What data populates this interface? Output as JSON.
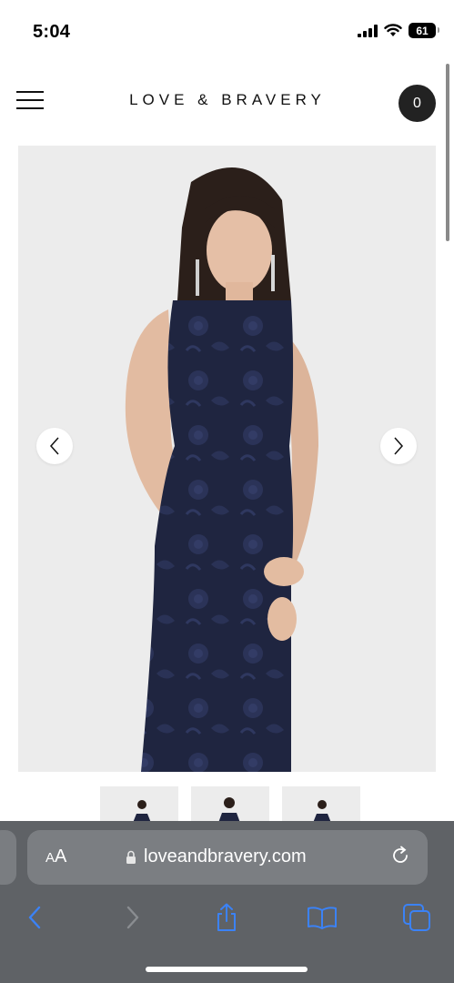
{
  "status_bar": {
    "time": "5:04",
    "battery_level": "61",
    "icons": [
      "cellular-signal-icon",
      "wifi-icon",
      "battery-icon"
    ]
  },
  "header": {
    "brand": "LOVE & BRAVERY",
    "cart_count": "0",
    "icons": [
      "hamburger-menu-icon"
    ]
  },
  "carousel": {
    "image_alt": "Model wearing navy floral jacquard sleeveless qipao dress",
    "prev_icon": "chevron-left-icon",
    "next_icon": "chevron-right-icon",
    "thumbnail_count": 3
  },
  "browser": {
    "aa_label_small": "A",
    "aa_label_large": "A",
    "url": "loveandbravery.com",
    "icons": [
      "lock-icon",
      "reload-icon",
      "back-icon",
      "forward-icon",
      "share-icon",
      "bookmarks-icon",
      "tabs-icon"
    ]
  },
  "colors": {
    "dress_navy": "#1f2540",
    "browser_chrome": "#5f6266",
    "address_field": "#7b7e82",
    "toolbar_accent": "#3b82f6"
  }
}
